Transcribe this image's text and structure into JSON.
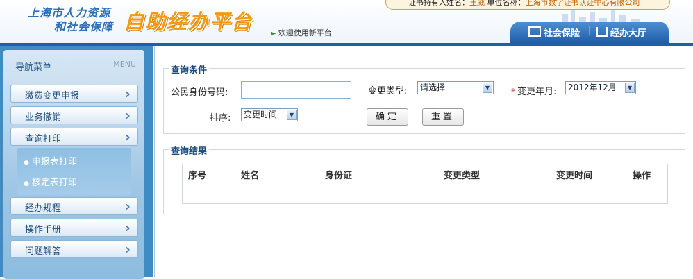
{
  "header": {
    "logo_line1": "上海市人力资源",
    "logo_line2": "和社会保障",
    "platform_title": "自助经办平台",
    "welcome": "欢迎使用新平台",
    "user_label": "证书持有人姓名：",
    "user_name": "王威",
    "org_label": "单位名称：",
    "org_name": "上海市数字证书认证中心有限公司",
    "nav": [
      "社会保险",
      "经办大厅"
    ]
  },
  "sidebar": {
    "title": "导航菜单",
    "title_en": "MENU",
    "items": [
      {
        "label": "缴费变更申报"
      },
      {
        "label": "业务撤销"
      },
      {
        "label": "查询打印"
      },
      {
        "label": "经办规程"
      },
      {
        "label": "操作手册"
      },
      {
        "label": "问题解答"
      }
    ],
    "subitems": [
      "申报表打印",
      "核定表打印"
    ]
  },
  "query": {
    "legend": "查询条件",
    "id_label": "公民身份号码:",
    "id_value": "",
    "type_label": "变更类型:",
    "type_value": "请选择",
    "month_required": "*",
    "month_label": "变更年月:",
    "month_value": "2012年12月",
    "sort_label": "排序:",
    "sort_value": "变更时间",
    "confirm_button": "确定",
    "reset_button": "重置"
  },
  "results": {
    "legend": "查询结果",
    "columns": [
      "序号",
      "姓名",
      "身份证",
      "变更类型",
      "变更时间",
      "操作"
    ],
    "rows": []
  },
  "colors": {
    "accent_blue": "#1f5ea8",
    "brand_orange": "#f39a12",
    "sidebar_blue": "#3f8bc3"
  }
}
